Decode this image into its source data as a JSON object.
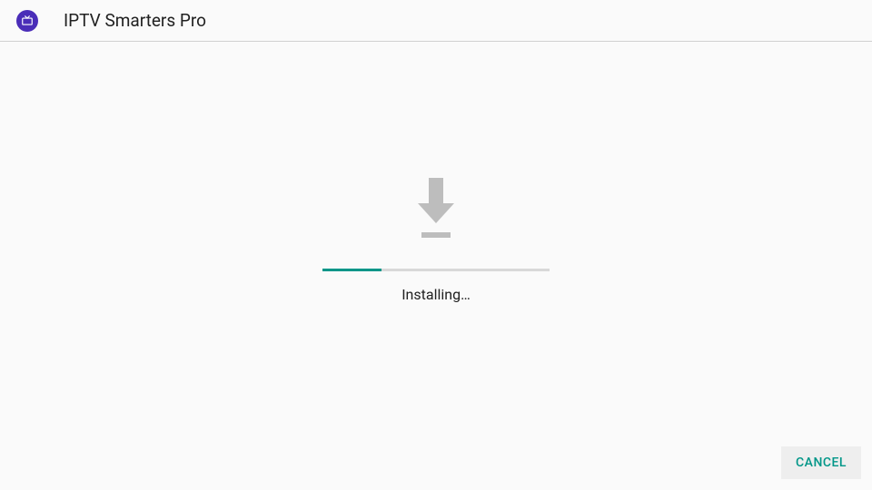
{
  "header": {
    "app_title": "IPTV Smarters Pro"
  },
  "installer": {
    "status_text": "Installing…",
    "progress_percent": 26
  },
  "footer": {
    "cancel_label": "CANCEL"
  },
  "colors": {
    "accent": "#009688",
    "icon_bg": "#4a2db8"
  }
}
